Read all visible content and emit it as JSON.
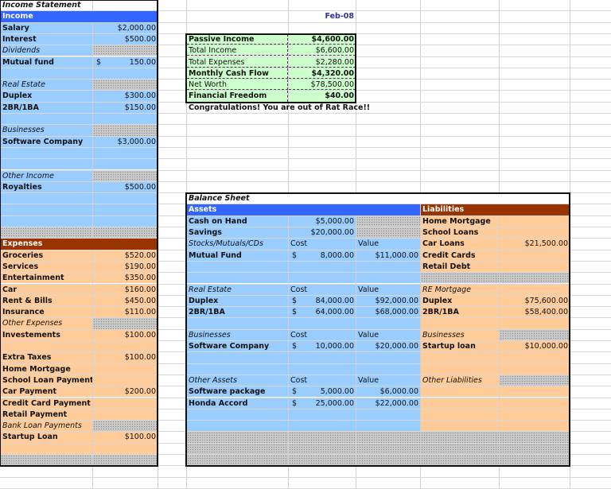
{
  "income_statement": {
    "title": "Income Statement",
    "income_header": "Income",
    "rows": [
      {
        "label": "Salary",
        "value": "$2,000.00",
        "style": "b"
      },
      {
        "label": "Interest",
        "value": "$500.00",
        "style": "b"
      },
      {
        "label": "Dividends",
        "value": "",
        "style": "i",
        "hatch": true
      },
      {
        "label": "Mutual fund",
        "value": "150.00",
        "dollar": "$",
        "style": "b"
      },
      {
        "label": "",
        "value": "",
        "style": ""
      },
      {
        "label": "Real Estate",
        "value": "",
        "style": "i",
        "hatch": true
      },
      {
        "label": "Duplex",
        "value": "$300.00",
        "style": "b"
      },
      {
        "label": "2BR/1BA",
        "value": "$150.00",
        "style": "b"
      },
      {
        "label": "",
        "value": "",
        "style": ""
      },
      {
        "label": "Businesses",
        "value": "",
        "style": "i",
        "hatch": true
      },
      {
        "label": "Software Company",
        "value": "$3,000.00",
        "style": "b"
      },
      {
        "label": "",
        "value": "",
        "style": ""
      },
      {
        "label": "",
        "value": "",
        "style": ""
      },
      {
        "label": "Other Income",
        "value": "",
        "style": "i",
        "hatch": true
      },
      {
        "label": "Royalties",
        "value": "$500.00",
        "style": "b"
      },
      {
        "label": "",
        "value": "",
        "style": ""
      },
      {
        "label": "",
        "value": "",
        "style": ""
      },
      {
        "label": "",
        "value": "",
        "style": ""
      }
    ],
    "expenses_header": "Expenses",
    "expense_rows": [
      {
        "label": "Groceries",
        "value": "$520.00",
        "style": "b"
      },
      {
        "label": "Services",
        "value": "$190.00",
        "style": "b"
      },
      {
        "label": "Entertainment",
        "value": "$350.00",
        "style": "b"
      },
      {
        "label": "Car",
        "value": "$160.00",
        "style": "b"
      },
      {
        "label": "Rent & Bills",
        "value": "$450.00",
        "style": "b"
      },
      {
        "label": "Insurance",
        "value": "$110.00",
        "style": "b"
      },
      {
        "label": "Other Expenses",
        "value": "",
        "style": "i",
        "hatch": true
      },
      {
        "label": "Investements",
        "value": "$100.00",
        "style": "b"
      },
      {
        "label": "",
        "value": "",
        "style": ""
      },
      {
        "label": "Extra Taxes",
        "value": "$100.00",
        "style": "b"
      },
      {
        "label": "Home Mortgage",
        "value": "",
        "style": "b"
      },
      {
        "label": "School Loan Payment",
        "value": "",
        "style": "b"
      },
      {
        "label": "Car Payment",
        "value": "$200.00",
        "style": "b"
      },
      {
        "label": "Credit Card Payment",
        "value": "",
        "style": "b"
      },
      {
        "label": "Retail Payment",
        "value": "",
        "style": "b"
      },
      {
        "label": "Bank Loan Payments",
        "value": "",
        "style": "i",
        "hatch": true
      },
      {
        "label": "Startup Loan",
        "value": "$100.00",
        "style": "b"
      },
      {
        "label": "",
        "value": "",
        "style": ""
      }
    ]
  },
  "summary": {
    "date": "Feb-08",
    "rows": [
      {
        "label": "Passive Income",
        "value": "$4,600.00",
        "bold": true
      },
      {
        "label": "Total Income",
        "value": "$6,600.00",
        "bold": false
      },
      {
        "label": "Total Expenses",
        "value": "$2,280.00",
        "bold": false
      },
      {
        "label": "Monthly Cash Flow",
        "value": "$4,320.00",
        "bold": true
      },
      {
        "label": "Net Worth",
        "value": "$78,500.00",
        "bold": false
      },
      {
        "label": "Financial Freedom",
        "value": "$40.00",
        "bold": true
      }
    ],
    "message": "Congratulations! You are out of Rat Race!!"
  },
  "balance_sheet": {
    "title": "Balance Sheet",
    "assets_header": "Assets",
    "liabilities_header": "Liabilities",
    "asset_rows": [
      {
        "label": "Cash on Hand",
        "cost": "$5,000.00",
        "value": "",
        "style": "b",
        "hatchValue": true
      },
      {
        "label": "Savings",
        "cost": "$20,000.00",
        "value": "",
        "style": "b",
        "hatchValue": true
      },
      {
        "label": "Stocks/Mutuals/CDs",
        "cost": "Cost",
        "value": "Value",
        "style": "i",
        "header": true
      },
      {
        "label": "Mutual Fund",
        "cost": "8,000.00",
        "dollar": "$",
        "value": "$11,000.00",
        "style": "b"
      },
      {
        "label": "",
        "cost": "",
        "value": "",
        "style": ""
      },
      {
        "label": "",
        "cost": "",
        "value": "",
        "style": ""
      },
      {
        "label": "Real Estate",
        "cost": "Cost",
        "value": "Value",
        "style": "i",
        "header": true
      },
      {
        "label": "Duplex",
        "cost": "84,000.00",
        "dollar": "$",
        "value": "$92,000.00",
        "style": "b"
      },
      {
        "label": "2BR/1BA",
        "cost": "64,000.00",
        "dollar": "$",
        "value": "$68,000.00",
        "style": "b"
      },
      {
        "label": "",
        "cost": "",
        "value": "",
        "style": ""
      },
      {
        "label": "Businesses",
        "cost": "Cost",
        "value": "Value",
        "style": "i",
        "header": true
      },
      {
        "label": "Software Company",
        "cost": "10,000.00",
        "dollar": "$",
        "value": "$20,000.00",
        "style": "b"
      },
      {
        "label": "",
        "cost": "",
        "value": "",
        "style": ""
      },
      {
        "label": "",
        "cost": "",
        "value": "",
        "style": ""
      },
      {
        "label": "Other Assets",
        "cost": "Cost",
        "value": "Value",
        "style": "i",
        "header": true
      },
      {
        "label": "Software package",
        "cost": "5,000.00",
        "dollar": "$",
        "value": "$6,000.00",
        "style": "b"
      },
      {
        "label": "Honda Accord",
        "cost": "25,000.00",
        "dollar": "$",
        "value": "$22,000.00",
        "style": "b"
      },
      {
        "label": "",
        "cost": "",
        "value": "",
        "style": ""
      },
      {
        "label": "",
        "cost": "",
        "value": "",
        "style": ""
      }
    ],
    "liability_rows": [
      {
        "label": "Home Mortgage",
        "value": "",
        "style": "b"
      },
      {
        "label": "School Loans",
        "value": "",
        "style": "b"
      },
      {
        "label": "Car Loans",
        "value": "$21,500.00",
        "style": "b"
      },
      {
        "label": "Credit Cards",
        "value": "",
        "style": "b"
      },
      {
        "label": "Retail Debt",
        "value": "",
        "style": "b"
      },
      {
        "label": "",
        "value": "",
        "style": "",
        "hatchAll": true
      },
      {
        "label": "RE Mortgage",
        "value": "",
        "style": "i"
      },
      {
        "label": "Duplex",
        "value": "$75,600.00",
        "style": "b"
      },
      {
        "label": "2BR/1BA",
        "value": "$58,400.00",
        "style": "b"
      },
      {
        "label": "",
        "value": "",
        "style": ""
      },
      {
        "label": "Businesses",
        "value": "",
        "style": "i",
        "hatch": true
      },
      {
        "label": "Startup loan",
        "value": "$10,000.00",
        "style": "b"
      },
      {
        "label": "",
        "value": "",
        "style": ""
      },
      {
        "label": "",
        "value": "",
        "style": ""
      },
      {
        "label": "Other Liabilities",
        "value": "",
        "style": "i",
        "hatch": true
      },
      {
        "label": "",
        "value": "",
        "style": ""
      },
      {
        "label": "",
        "value": "",
        "style": ""
      },
      {
        "label": "",
        "value": "",
        "style": ""
      },
      {
        "label": "",
        "value": "",
        "style": ""
      }
    ]
  },
  "colors": {
    "income_header": "#3366ff",
    "expense_header": "#993300",
    "income_fill": "#99ccff",
    "expense_fill": "#ffcc99",
    "summary_fill": "#ccffcc",
    "date_text": "#333399"
  }
}
